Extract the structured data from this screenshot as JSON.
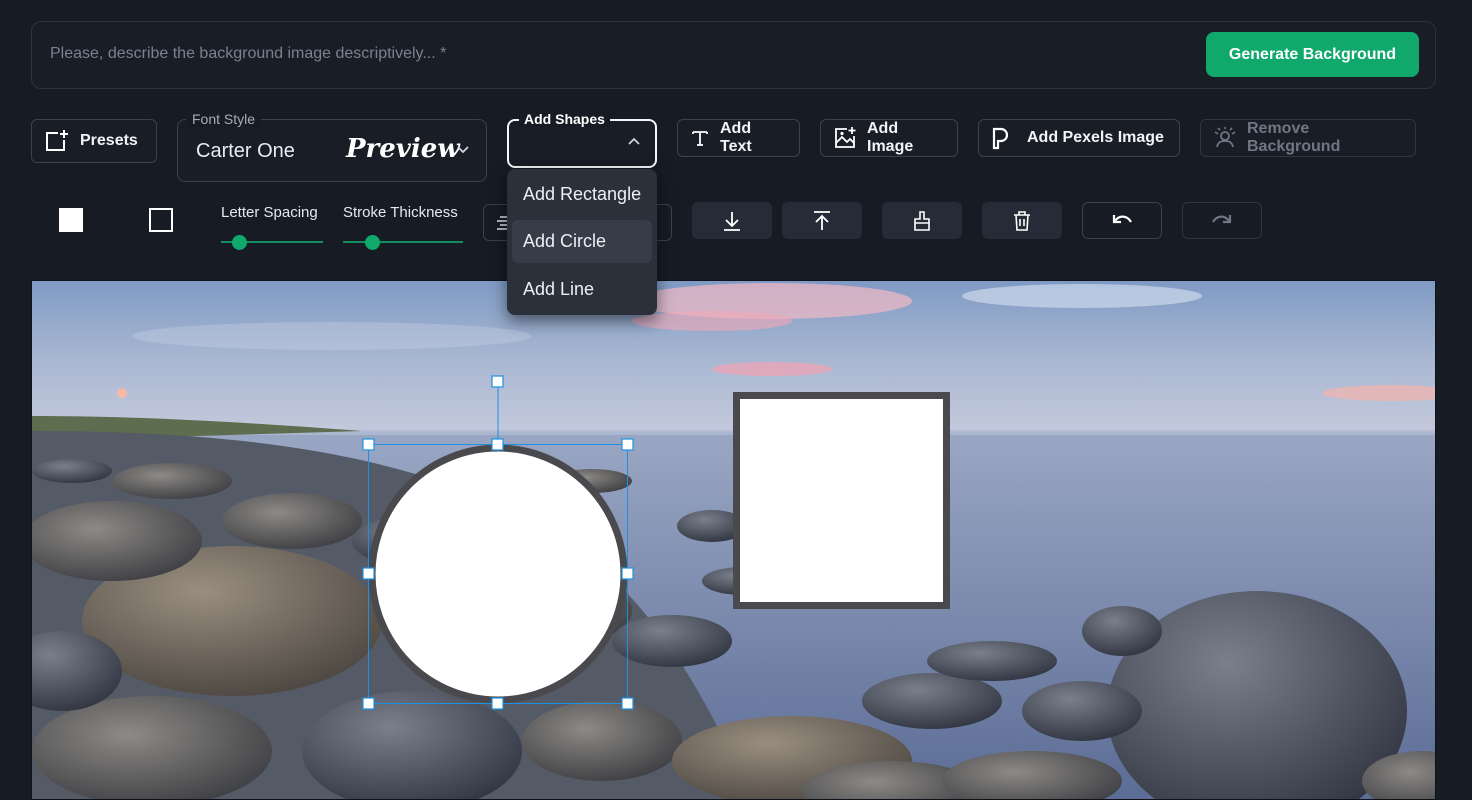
{
  "prompt": {
    "placeholder": "Please, describe the background image descriptively... *",
    "generate_label": "Generate Background"
  },
  "toolbar": {
    "presets_label": "Presets",
    "font_style": {
      "label": "Font Style",
      "value": "Carter One",
      "preview": "Preview"
    },
    "add_shapes": {
      "label": "Add Shapes",
      "expanded": true,
      "options": [
        "Add Rectangle",
        "Add Circle",
        "Add Line"
      ],
      "hovered": "Add Circle"
    },
    "add_text_label": "Add Text",
    "add_image_label": "Add Image",
    "add_pexels_label": "Add Pexels Image",
    "remove_bg_label": "Remove Background"
  },
  "controls": {
    "letter_spacing_label": "Letter Spacing",
    "letter_spacing_value": 0.18,
    "stroke_thickness_label": "Stroke Thickness",
    "stroke_thickness_value": 0.3
  },
  "colors": {
    "accent": "#10a86b",
    "background": "#161b24",
    "selection": "#1e90e0"
  },
  "icons": {
    "presets": "add-square-icon",
    "add_text": "text-icon",
    "add_image": "image-plus-icon",
    "add_pexels": "pexels-p-icon",
    "remove_bg": "remove-bg-icon",
    "bring_down": "download-arrow-icon",
    "bring_up": "upload-arrow-icon",
    "brush": "brush-icon",
    "delete": "trash-icon",
    "undo": "undo-icon",
    "redo": "redo-icon"
  }
}
